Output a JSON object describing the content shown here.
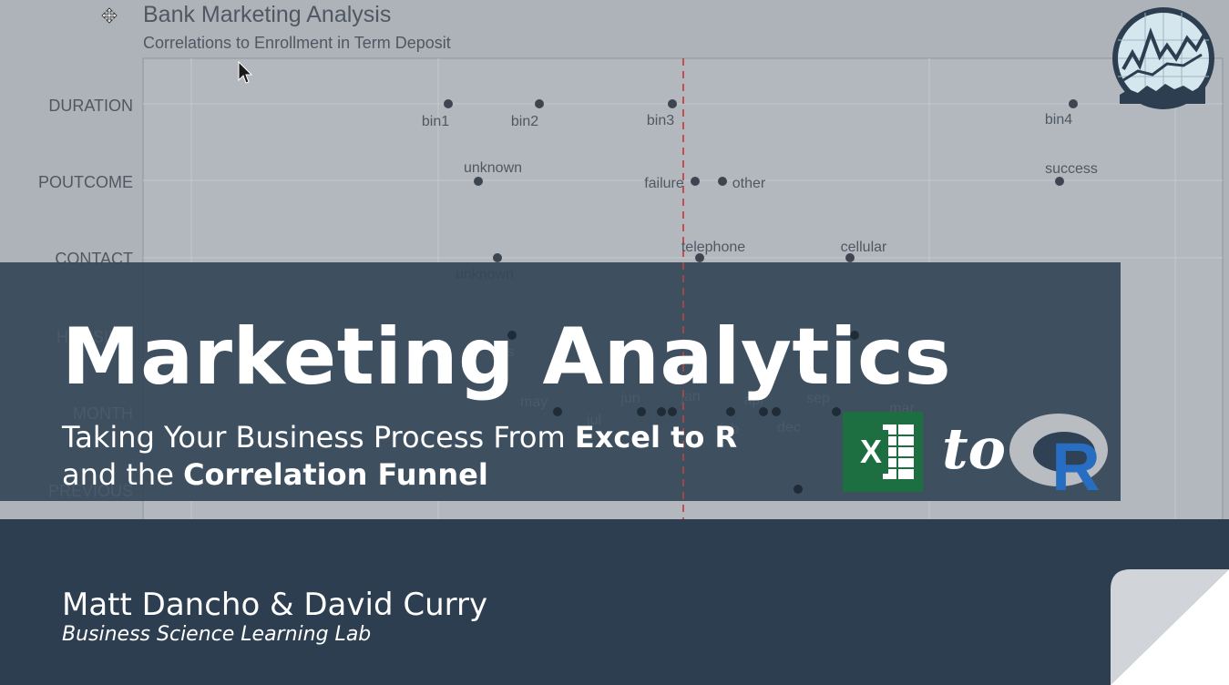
{
  "background_chart": {
    "title": "Bank Marketing Analysis",
    "subtitle": "Correlations to Enrollment in Term Deposit",
    "row_labels": [
      "DURATION",
      "POUTCOME",
      "CONTACT",
      "HOUSING",
      "MONTH",
      "PREVIOUS"
    ],
    "point_labels": [
      "bin1",
      "bin2",
      "bin3",
      "bin4",
      "unknown",
      "failure",
      "other",
      "success",
      "telephone",
      "cellular",
      "unknown",
      "yes",
      "may",
      "jun",
      "jul",
      "jan",
      "apr",
      "sep",
      "mar",
      "dec",
      "feb"
    ]
  },
  "hero": {
    "title": "Marketing Analytics",
    "subtitle_line1_prefix": "Taking Your Business Process From ",
    "subtitle_line1_bold": "Excel to R",
    "subtitle_line2_prefix": "and the ",
    "subtitle_line2_bold": "Correlation Funnel"
  },
  "logos": {
    "excel_letter": "X",
    "to_word": "to",
    "r_letter": "R"
  },
  "footer": {
    "authors": "Matt Dancho & David Curry",
    "organization": "Business Science Learning Lab"
  },
  "colors": {
    "title_band": "#344658",
    "bottom_band": "#2c3e50",
    "chart_background": "#aeb3ba",
    "excel_green": "#1d6f42",
    "r_blue": "#276dc2",
    "zero_line": "#c0504d"
  },
  "icons": [
    "move-icon",
    "mouse-cursor-icon",
    "excel-logo-icon",
    "r-logo-icon",
    "business-science-logo-icon",
    "page-curl-icon"
  ]
}
